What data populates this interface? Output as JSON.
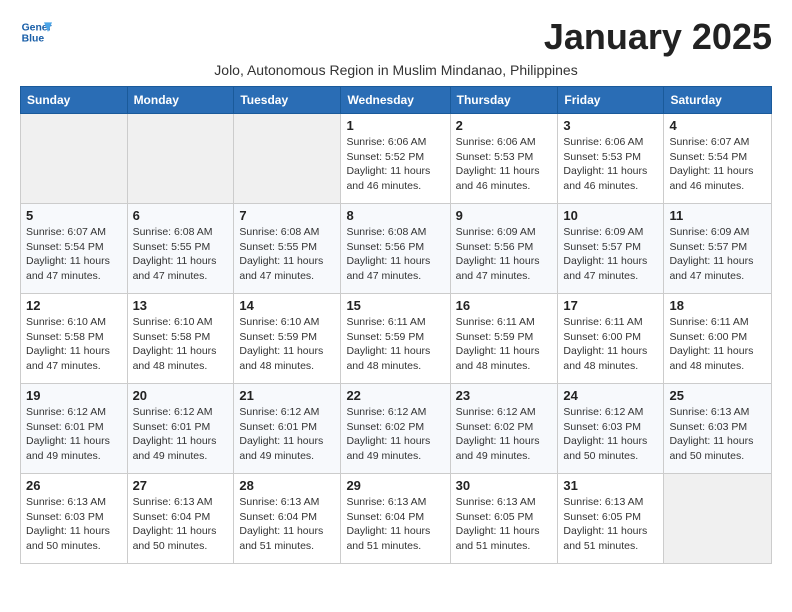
{
  "header": {
    "logo_line1": "General",
    "logo_line2": "Blue",
    "month_title": "January 2025",
    "subtitle": "Jolo, Autonomous Region in Muslim Mindanao, Philippines"
  },
  "weekdays": [
    "Sunday",
    "Monday",
    "Tuesday",
    "Wednesday",
    "Thursday",
    "Friday",
    "Saturday"
  ],
  "weeks": [
    [
      {
        "day": "",
        "info": ""
      },
      {
        "day": "",
        "info": ""
      },
      {
        "day": "",
        "info": ""
      },
      {
        "day": "1",
        "info": "Sunrise: 6:06 AM\nSunset: 5:52 PM\nDaylight: 11 hours\nand 46 minutes."
      },
      {
        "day": "2",
        "info": "Sunrise: 6:06 AM\nSunset: 5:53 PM\nDaylight: 11 hours\nand 46 minutes."
      },
      {
        "day": "3",
        "info": "Sunrise: 6:06 AM\nSunset: 5:53 PM\nDaylight: 11 hours\nand 46 minutes."
      },
      {
        "day": "4",
        "info": "Sunrise: 6:07 AM\nSunset: 5:54 PM\nDaylight: 11 hours\nand 46 minutes."
      }
    ],
    [
      {
        "day": "5",
        "info": "Sunrise: 6:07 AM\nSunset: 5:54 PM\nDaylight: 11 hours\nand 47 minutes."
      },
      {
        "day": "6",
        "info": "Sunrise: 6:08 AM\nSunset: 5:55 PM\nDaylight: 11 hours\nand 47 minutes."
      },
      {
        "day": "7",
        "info": "Sunrise: 6:08 AM\nSunset: 5:55 PM\nDaylight: 11 hours\nand 47 minutes."
      },
      {
        "day": "8",
        "info": "Sunrise: 6:08 AM\nSunset: 5:56 PM\nDaylight: 11 hours\nand 47 minutes."
      },
      {
        "day": "9",
        "info": "Sunrise: 6:09 AM\nSunset: 5:56 PM\nDaylight: 11 hours\nand 47 minutes."
      },
      {
        "day": "10",
        "info": "Sunrise: 6:09 AM\nSunset: 5:57 PM\nDaylight: 11 hours\nand 47 minutes."
      },
      {
        "day": "11",
        "info": "Sunrise: 6:09 AM\nSunset: 5:57 PM\nDaylight: 11 hours\nand 47 minutes."
      }
    ],
    [
      {
        "day": "12",
        "info": "Sunrise: 6:10 AM\nSunset: 5:58 PM\nDaylight: 11 hours\nand 47 minutes."
      },
      {
        "day": "13",
        "info": "Sunrise: 6:10 AM\nSunset: 5:58 PM\nDaylight: 11 hours\nand 48 minutes."
      },
      {
        "day": "14",
        "info": "Sunrise: 6:10 AM\nSunset: 5:59 PM\nDaylight: 11 hours\nand 48 minutes."
      },
      {
        "day": "15",
        "info": "Sunrise: 6:11 AM\nSunset: 5:59 PM\nDaylight: 11 hours\nand 48 minutes."
      },
      {
        "day": "16",
        "info": "Sunrise: 6:11 AM\nSunset: 5:59 PM\nDaylight: 11 hours\nand 48 minutes."
      },
      {
        "day": "17",
        "info": "Sunrise: 6:11 AM\nSunset: 6:00 PM\nDaylight: 11 hours\nand 48 minutes."
      },
      {
        "day": "18",
        "info": "Sunrise: 6:11 AM\nSunset: 6:00 PM\nDaylight: 11 hours\nand 48 minutes."
      }
    ],
    [
      {
        "day": "19",
        "info": "Sunrise: 6:12 AM\nSunset: 6:01 PM\nDaylight: 11 hours\nand 49 minutes."
      },
      {
        "day": "20",
        "info": "Sunrise: 6:12 AM\nSunset: 6:01 PM\nDaylight: 11 hours\nand 49 minutes."
      },
      {
        "day": "21",
        "info": "Sunrise: 6:12 AM\nSunset: 6:01 PM\nDaylight: 11 hours\nand 49 minutes."
      },
      {
        "day": "22",
        "info": "Sunrise: 6:12 AM\nSunset: 6:02 PM\nDaylight: 11 hours\nand 49 minutes."
      },
      {
        "day": "23",
        "info": "Sunrise: 6:12 AM\nSunset: 6:02 PM\nDaylight: 11 hours\nand 49 minutes."
      },
      {
        "day": "24",
        "info": "Sunrise: 6:12 AM\nSunset: 6:03 PM\nDaylight: 11 hours\nand 50 minutes."
      },
      {
        "day": "25",
        "info": "Sunrise: 6:13 AM\nSunset: 6:03 PM\nDaylight: 11 hours\nand 50 minutes."
      }
    ],
    [
      {
        "day": "26",
        "info": "Sunrise: 6:13 AM\nSunset: 6:03 PM\nDaylight: 11 hours\nand 50 minutes."
      },
      {
        "day": "27",
        "info": "Sunrise: 6:13 AM\nSunset: 6:04 PM\nDaylight: 11 hours\nand 50 minutes."
      },
      {
        "day": "28",
        "info": "Sunrise: 6:13 AM\nSunset: 6:04 PM\nDaylight: 11 hours\nand 51 minutes."
      },
      {
        "day": "29",
        "info": "Sunrise: 6:13 AM\nSunset: 6:04 PM\nDaylight: 11 hours\nand 51 minutes."
      },
      {
        "day": "30",
        "info": "Sunrise: 6:13 AM\nSunset: 6:05 PM\nDaylight: 11 hours\nand 51 minutes."
      },
      {
        "day": "31",
        "info": "Sunrise: 6:13 AM\nSunset: 6:05 PM\nDaylight: 11 hours\nand 51 minutes."
      },
      {
        "day": "",
        "info": ""
      }
    ]
  ]
}
